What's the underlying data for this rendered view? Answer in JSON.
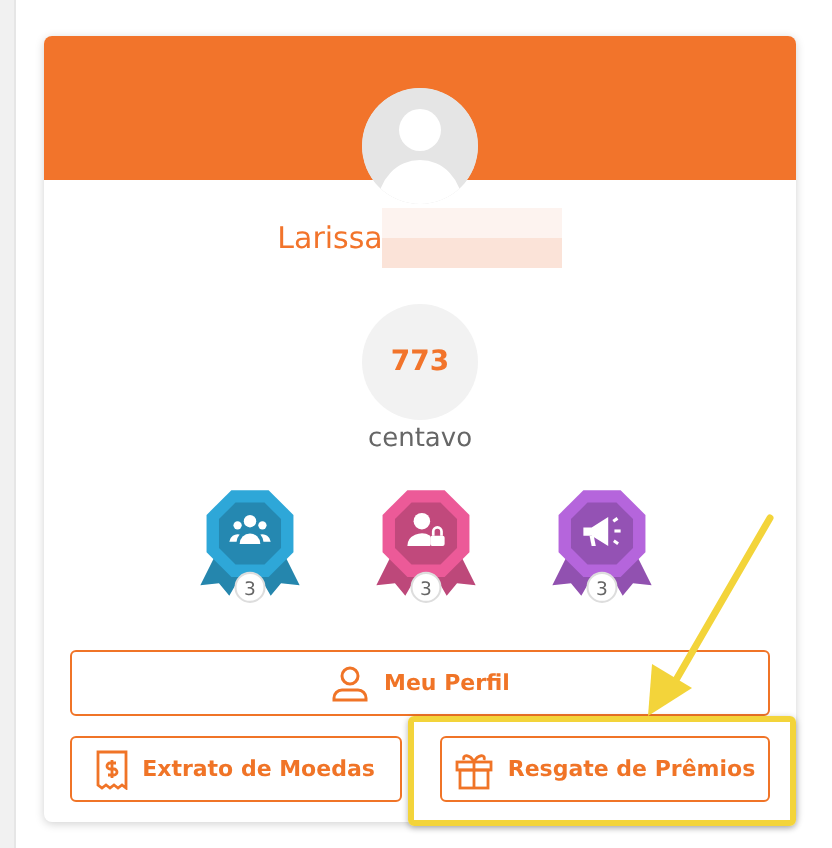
{
  "profile": {
    "name": "Larissa",
    "coins": "773",
    "coin_unit": "centavo"
  },
  "badges": [
    {
      "kind": "group",
      "color": "#2ea7d8",
      "count": "3"
    },
    {
      "kind": "user-lock",
      "color": "#ec5a98",
      "count": "3"
    },
    {
      "kind": "megaphone",
      "color": "#b565dc",
      "count": "3"
    }
  ],
  "buttons": [
    {
      "kind": "profile",
      "label": "Meu Perfil"
    },
    {
      "kind": "statement",
      "label": "Extrato de Moedas"
    },
    {
      "kind": "gift",
      "label": "Resgate de Prêmios",
      "highlighted": true
    }
  ]
}
